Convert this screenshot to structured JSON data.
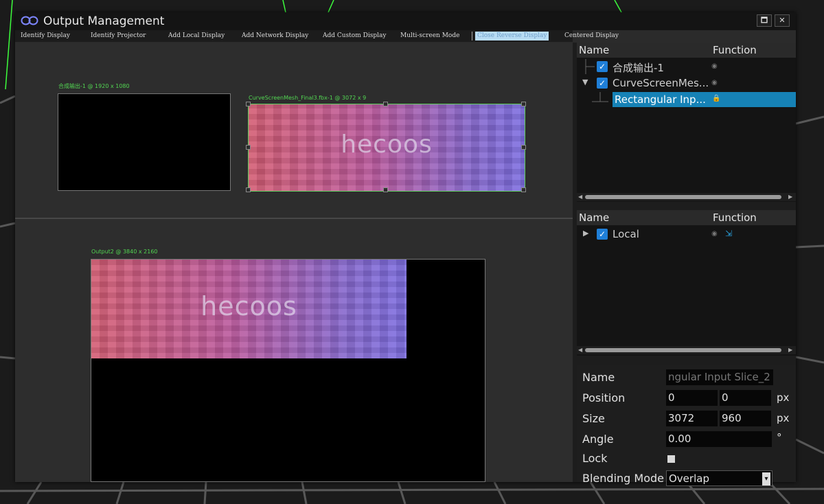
{
  "window": {
    "title": "Output Management",
    "maximize_icon": "maximize-icon",
    "close_icon": "close-icon",
    "maximize_label": "🗖",
    "close_label": "✕"
  },
  "menu": [
    "Identify Display",
    "Identify Projector",
    "Add Local Display",
    "Add Network Display",
    "Add Custom Display",
    "Multi-screen Mode",
    "Close Reverse Display",
    "Centered Display"
  ],
  "canvas": {
    "display1_label": "合成输出-1 @ 1920 x 1080",
    "display2_label": "CurveScreenMesh_Final3.fbx-1 @ 3072 x 9",
    "output2_label": "Output2 @ 3840 x 2160",
    "mesh_logo": "hecoos"
  },
  "tree_panel": {
    "col_name": "Name",
    "col_function": "Function",
    "rows": [
      {
        "label": "合成输出-1",
        "checked": true,
        "icon": "eye-icon"
      },
      {
        "label": "CurveScreenMes...",
        "checked": true,
        "icon": "eye-icon",
        "expanded": true
      },
      {
        "label": "Rectangular Inp...",
        "selected": true,
        "icon": "lock-icon"
      }
    ]
  },
  "output_panel": {
    "col_name": "Name",
    "col_function": "Function",
    "rows": [
      {
        "label": "Local",
        "checked": true,
        "icon": "eye-icon",
        "extra_icon": "export-icon",
        "expanded": false
      }
    ]
  },
  "properties": {
    "name_label": "Name",
    "name_value": "ngular Input Slice_2",
    "position_label": "Position",
    "position_x": "0",
    "position_y": "0",
    "position_unit": "px",
    "size_label": "Size",
    "size_w": "3072",
    "size_h": "960",
    "size_unit": "px",
    "angle_label": "Angle",
    "angle_value": "0.00",
    "angle_unit": "°",
    "lock_label": "Lock",
    "blending_label": "Blending Mode",
    "blending_value": "Overlap"
  },
  "colors": {
    "accent": "#1f7fd8",
    "selection": "#1682b6",
    "label_green": "#52d652"
  }
}
